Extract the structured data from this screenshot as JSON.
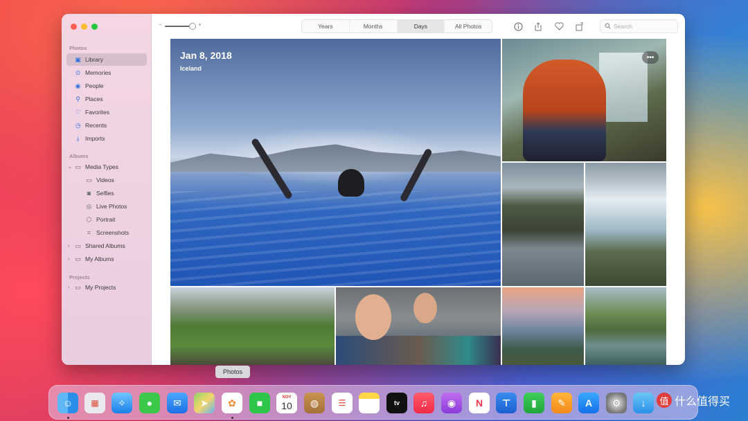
{
  "sidebar": {
    "sections": {
      "photos": "Photos",
      "albums": "Albums",
      "projects": "Projects"
    },
    "items": [
      {
        "label": "Library",
        "icon": "library-icon"
      },
      {
        "label": "Memories",
        "icon": "memories-icon"
      },
      {
        "label": "People",
        "icon": "people-icon"
      },
      {
        "label": "Places",
        "icon": "places-icon"
      },
      {
        "label": "Favorites",
        "icon": "heart-icon"
      },
      {
        "label": "Recents",
        "icon": "clock-icon"
      },
      {
        "label": "Imports",
        "icon": "import-icon"
      }
    ],
    "albums": [
      {
        "label": "Media Types"
      },
      {
        "label": "Videos"
      },
      {
        "label": "Selfies"
      },
      {
        "label": "Live Photos"
      },
      {
        "label": "Portrait"
      },
      {
        "label": "Screenshots"
      },
      {
        "label": "Shared Albums"
      },
      {
        "label": "My Albums"
      }
    ],
    "projects": [
      {
        "label": "My Projects"
      }
    ]
  },
  "toolbar": {
    "tabs": [
      "Years",
      "Months",
      "Days",
      "All Photos"
    ],
    "active_tab": "Days",
    "search_placeholder": "Search",
    "icons": [
      "info-icon",
      "share-icon",
      "heart-icon",
      "rotate-icon"
    ],
    "zoom_level": 0.8
  },
  "photos": {
    "main": {
      "date": "Jan 8, 2018",
      "place": "Iceland"
    },
    "more_label": "•••"
  },
  "tooltip": "Photos",
  "dock": {
    "apps": [
      "Finder",
      "Launchpad",
      "Safari",
      "Messages",
      "Mail",
      "Maps",
      "Photos",
      "FaceTime",
      "Calendar",
      "Contacts",
      "Reminders",
      "Notes",
      "TV",
      "Music",
      "Podcasts",
      "News",
      "Keynote",
      "Numbers",
      "Pages",
      "App Store",
      "System Preferences"
    ],
    "calendar_month": "NOV",
    "calendar_day": "10",
    "tv_label": "tv",
    "watermark": "什么值得买",
    "watermark_badge": "值"
  },
  "colors": {
    "accent": "#2f6fe0",
    "sidebar_selected": "#d8bfcd"
  }
}
